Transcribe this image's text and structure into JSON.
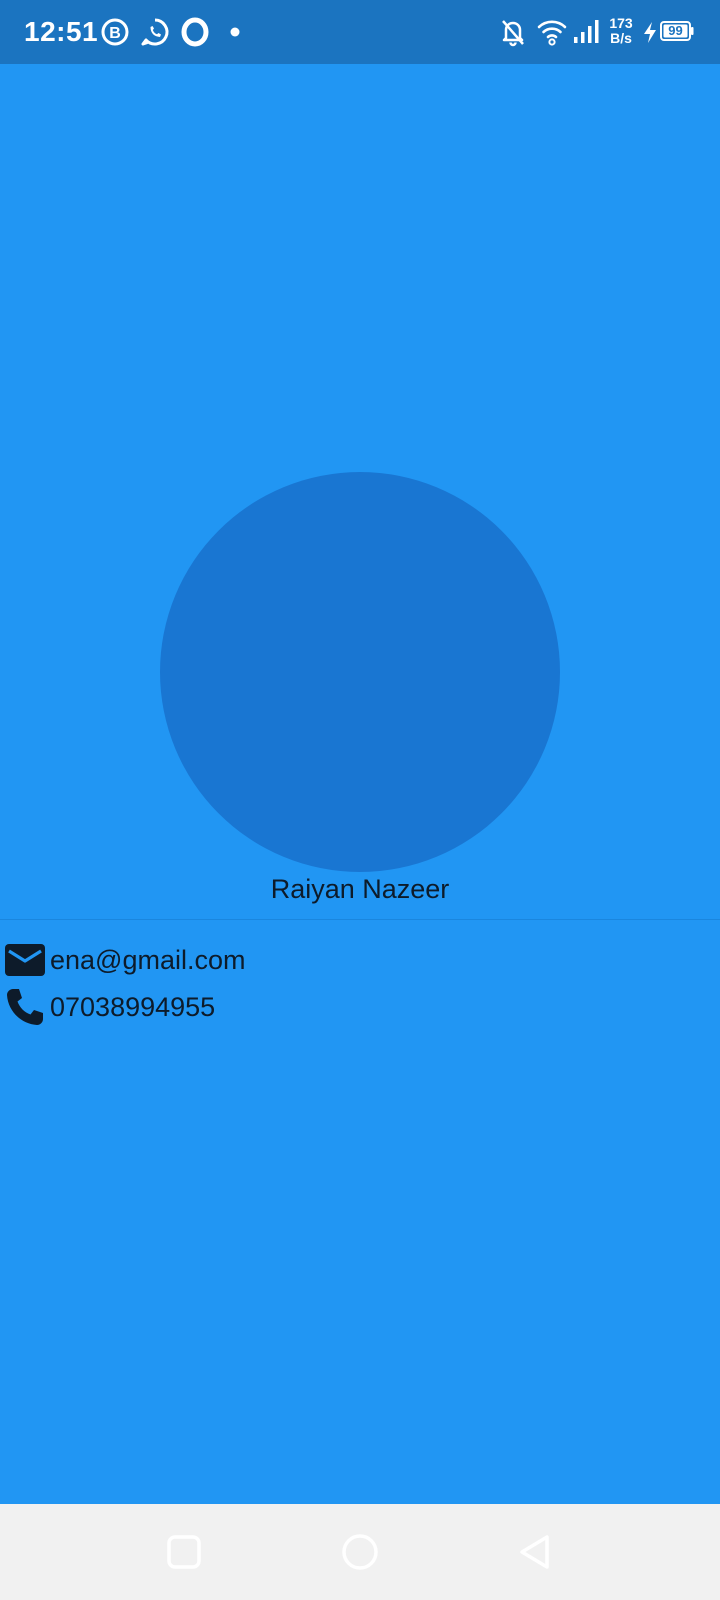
{
  "status_bar": {
    "time": "12:51",
    "net_speed_value": "173",
    "net_speed_unit": "B/s",
    "battery_level": "99",
    "icons": [
      "b-app-icon",
      "whatsapp-icon",
      "opera-icon",
      "notification-dot",
      "notifications-off-icon",
      "wifi-icon",
      "signal-icon",
      "charging-icon",
      "battery-icon"
    ]
  },
  "profile": {
    "name": "Raiyan Nazeer",
    "email": "ena@gmail.com",
    "phone": "07038994955"
  },
  "nav_bar": {
    "buttons": [
      "recents-button",
      "home-button",
      "back-button"
    ]
  },
  "colors": {
    "background": "#2196f3",
    "status_bar": "#1b74c0",
    "avatar": "#1976d2",
    "text": "#0d1b2a",
    "nav_bar": "#f1f1f1"
  }
}
